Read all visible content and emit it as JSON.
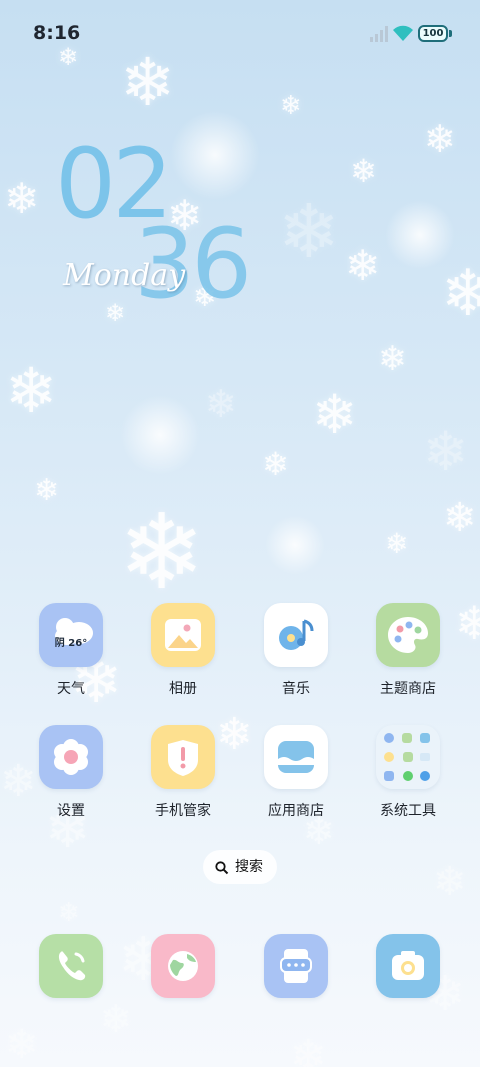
{
  "status_bar": {
    "time": "8:16",
    "battery": "100"
  },
  "clock": {
    "hours": "02",
    "minutes": "36",
    "day": "Monday"
  },
  "weather_badge": "阴 26°",
  "apps": [
    {
      "label": "天气"
    },
    {
      "label": "相册"
    },
    {
      "label": "音乐"
    },
    {
      "label": "主题商店"
    },
    {
      "label": "设置"
    },
    {
      "label": "手机管家"
    },
    {
      "label": "应用商店"
    },
    {
      "label": "系统工具"
    }
  ],
  "search": {
    "label": "搜索"
  },
  "dock": [
    {
      "icon": "phone-icon"
    },
    {
      "icon": "browser-globe-icon"
    },
    {
      "icon": "messages-icon"
    },
    {
      "icon": "camera-icon"
    }
  ],
  "colors": {
    "weather": "#a9c3f4",
    "gallery": "#fde08f",
    "music": "#ffffff",
    "theme": "#b6dba0",
    "settings": "#a9c3f4",
    "security": "#fde08f",
    "appstore": "#ffffff",
    "dock_phone": "#b6dfa6",
    "dock_browser": "#f9b9c9",
    "dock_messages": "#a9c3f4",
    "dock_camera": "#84c3ea"
  }
}
